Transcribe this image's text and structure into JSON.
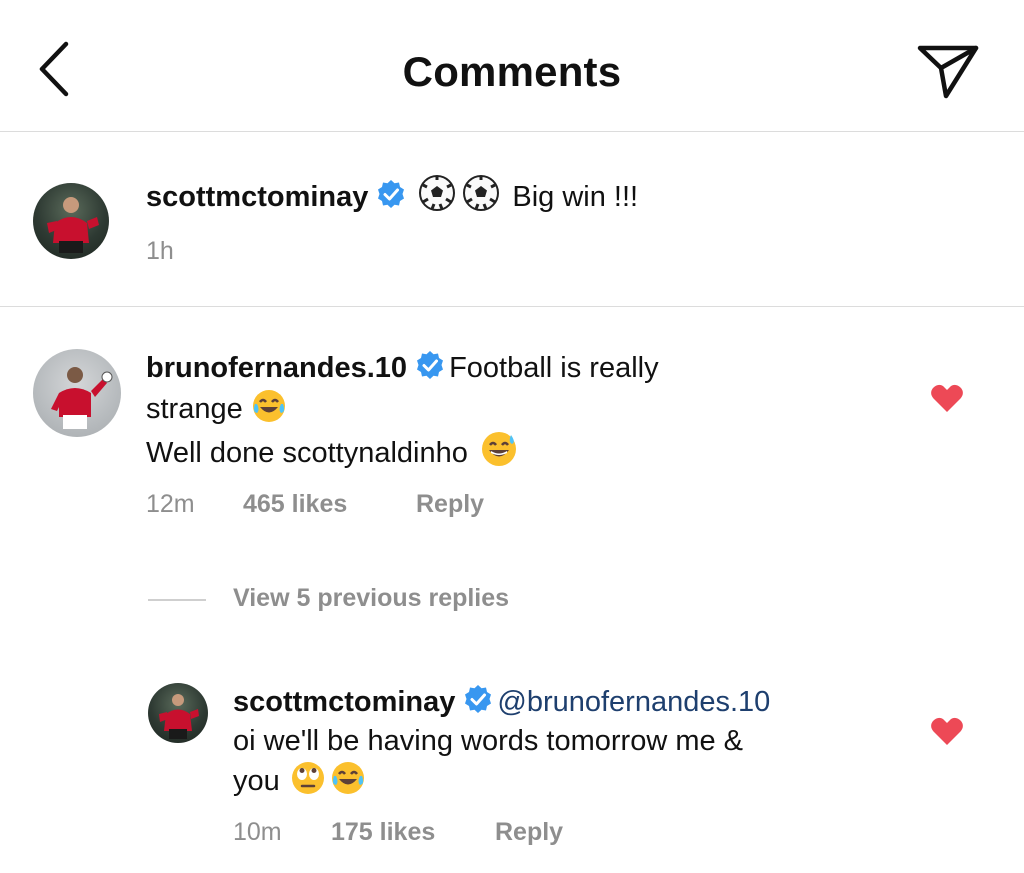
{
  "header": {
    "title": "Comments",
    "back_icon": "chevron-left-icon",
    "send_icon": "send-icon"
  },
  "caption": {
    "username": "scottmctominay",
    "verified": true,
    "emojis": [
      "soccer-ball-emoji",
      "soccer-ball-emoji"
    ],
    "text": "Big win !!!",
    "time": "1h"
  },
  "comment": {
    "username": "brunofernandes.10",
    "verified": true,
    "text_line1": "Football is really",
    "text_line2": "strange",
    "text_line3": "Well done scottynaldinho",
    "time": "12m",
    "likes": "465 likes",
    "reply_label": "Reply",
    "liked": true
  },
  "view_replies_label": "View 5 previous replies",
  "reply": {
    "username": "scottmctominay",
    "verified": true,
    "mention": "@brunofernandes.10",
    "text_line1": "oi we'll be having words tomorrow me &",
    "text_line2": "you",
    "time": "10m",
    "likes": "175 likes",
    "reply_label": "Reply",
    "liked": true
  },
  "colors": {
    "verified_blue": "#3897f0",
    "heart_red": "#ed4956",
    "meta_gray": "#8e8e8e",
    "mention_blue": "#1e3f6e"
  }
}
